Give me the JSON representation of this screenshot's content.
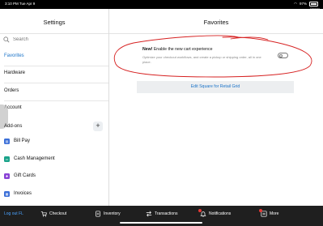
{
  "status_bar": {
    "time": "3:10 PM  Tue Apr 9",
    "battery": "97%",
    "printer": "Printer"
  },
  "sidebar": {
    "title": "Settings",
    "search_placeholder": "Search",
    "items": [
      {
        "label": "Favorites",
        "active": true
      },
      {
        "label": "Hardware"
      },
      {
        "label": "Orders"
      },
      {
        "label": "Account"
      }
    ],
    "addons_header": "Add-ons",
    "add_button": "+",
    "addons": [
      {
        "label": "Bill Pay",
        "icon": "bill-pay-icon",
        "color": "#3b6fd8"
      },
      {
        "label": "Cash Management",
        "icon": "cash-management-icon",
        "color": "#1aa38a"
      },
      {
        "label": "Gift Cards",
        "icon": "gift-cards-icon",
        "color": "#8b45d6"
      },
      {
        "label": "Invoices",
        "icon": "invoices-icon",
        "color": "#3b6fd8"
      }
    ]
  },
  "main": {
    "title": "Favorites",
    "cart": {
      "new_label": "New!",
      "title": " Enable the new cart experience",
      "description": "Optimize your checkout workflows, and create a pickup or shipping order, all in one place.",
      "toggle_on": false
    },
    "edit_button": "Edit Square for Retail Grid"
  },
  "tabbar": {
    "logout": "Log out FL",
    "tabs": [
      "Checkout",
      "Inventory",
      "Transactions",
      "Notifications",
      "More"
    ]
  },
  "colors": {
    "accent": "#1a73c8",
    "annotation": "#d62020",
    "tabbar": "#1f1f1f"
  }
}
